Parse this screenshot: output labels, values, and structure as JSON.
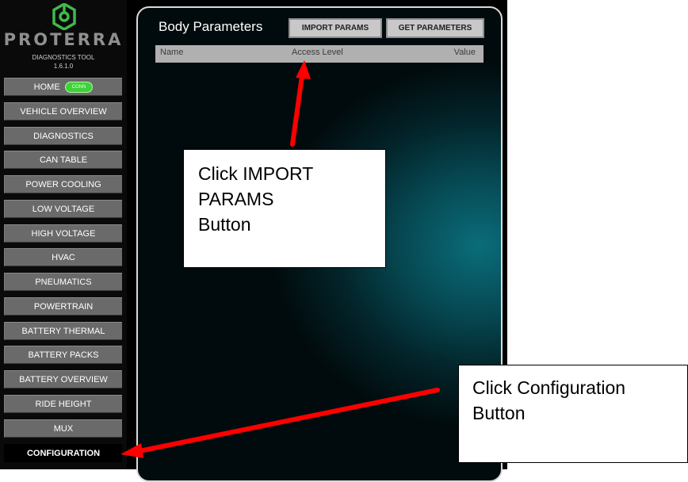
{
  "brand": {
    "name": "PROTERRA",
    "subtitle": "DIAGNOSTICS TOOL",
    "version": "1.6.1.0",
    "colors": {
      "brand_green": "#3fb94a",
      "nav_button": "#6a6a6a",
      "panel_teal": "#0a6d7a"
    }
  },
  "sidebar": {
    "items": [
      {
        "label": "HOME",
        "badge": "CONN",
        "active": false
      },
      {
        "label": "VEHICLE OVERVIEW",
        "active": false
      },
      {
        "label": "DIAGNOSTICS",
        "active": false
      },
      {
        "label": "CAN TABLE",
        "active": false
      },
      {
        "label": "POWER COOLING",
        "active": false
      },
      {
        "label": "LOW VOLTAGE",
        "active": false
      },
      {
        "label": "HIGH VOLTAGE",
        "active": false
      },
      {
        "label": "HVAC",
        "active": false
      },
      {
        "label": "PNEUMATICS",
        "active": false
      },
      {
        "label": "POWERTRAIN",
        "active": false
      },
      {
        "label": "BATTERY THERMAL",
        "active": false
      },
      {
        "label": "BATTERY PACKS",
        "active": false
      },
      {
        "label": "BATTERY OVERVIEW",
        "active": false
      },
      {
        "label": "RIDE HEIGHT",
        "active": false
      },
      {
        "label": "MUX",
        "active": false
      },
      {
        "label": "CONFIGURATION",
        "active": true
      }
    ]
  },
  "panel": {
    "title": "Body Parameters",
    "import_label": "IMPORT PARAMS",
    "get_label": "GET PARAMETERS",
    "columns": {
      "name": "Name",
      "access": "Access Level",
      "value": "Value"
    }
  },
  "annotations": {
    "import_callout": [
      "Click IMPORT",
      "PARAMS",
      "Button"
    ],
    "config_callout": [
      "Click Configuration",
      "Button"
    ],
    "arrow_color": "#ff0000"
  }
}
